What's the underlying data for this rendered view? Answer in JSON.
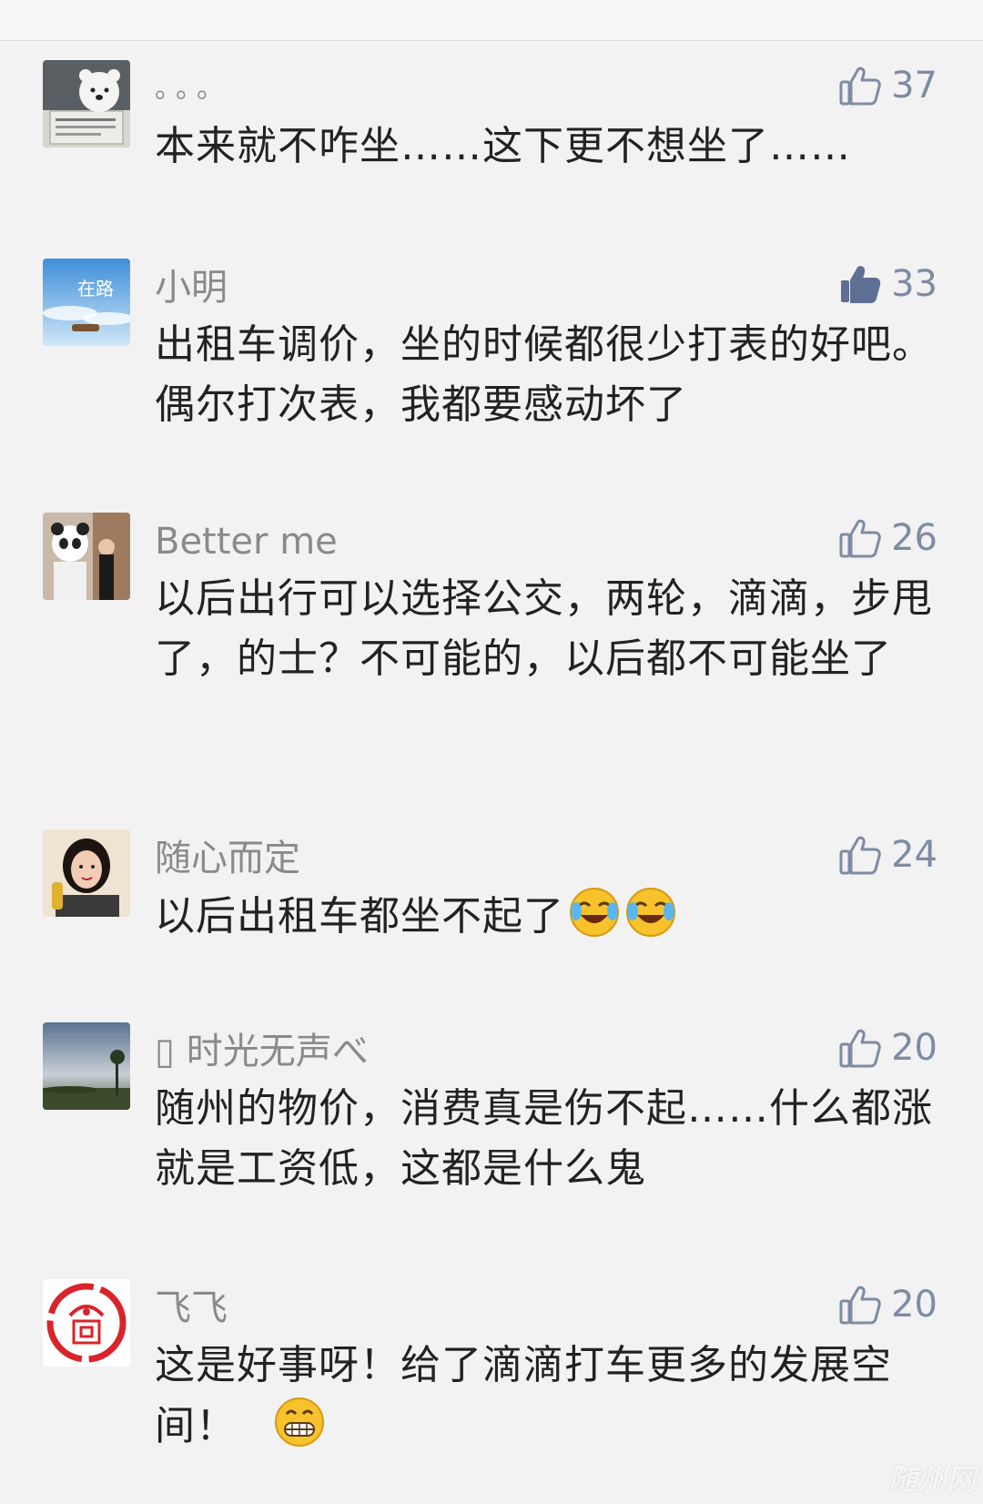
{
  "comments": [
    {
      "name": "。。。",
      "likes": "37",
      "liked": false,
      "text": "本来就不咋坐……这下更不想坐了……",
      "avatar": "bear-reading-newspaper-avatar"
    },
    {
      "name": "小明",
      "likes": "33",
      "liked": true,
      "text": "出租车调价，坐的时候都很少打表的好吧。偶尔打次表，我都要感动坏了",
      "avatar": "sky-road-poster-avatar"
    },
    {
      "name": "Better me",
      "likes": "26",
      "liked": false,
      "text": "以后出行可以选择公交，两轮，滴滴，步甩了，的士？不可能的，以后都不可能坐了",
      "avatar": "panda-and-woman-photo-avatar"
    },
    {
      "name": "随心而定",
      "likes": "24",
      "liked": false,
      "text": "以后出租车都坐不起了",
      "emojis": [
        "crying-laughing-emoji",
        "crying-laughing-emoji"
      ],
      "avatar": "woman-selfie-avatar"
    },
    {
      "name": "▯ 时光无声べ",
      "likes": "20",
      "liked": false,
      "text": "随州的物价，消费真是伤不起……什么都涨就是工资低，这都是什么鬼",
      "avatar": "sunset-landscape-avatar"
    },
    {
      "name": "飞飞",
      "likes": "20",
      "liked": false,
      "text": "这是好事呀！给了滴滴打车更多的发展空间！",
      "emojis": [
        "grinning-emoji"
      ],
      "avatar": "red-seal-logo-avatar"
    }
  ],
  "watermark": "随州网",
  "colors": {
    "background": "#f2f2f2",
    "name": "#8a8a8a",
    "like": "#7e8ba3",
    "text": "#222222"
  }
}
